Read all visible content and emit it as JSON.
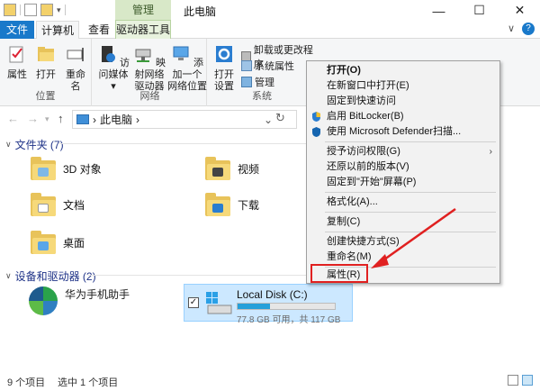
{
  "titlebar": {
    "manage_tab": "管理",
    "title": "此电脑",
    "minimize": "—",
    "maximize": "☐",
    "close": "✕"
  },
  "ribbon_tabs": {
    "file": "文件",
    "computer": "计算机",
    "view": "查看",
    "drive_tools": "驱动器工具",
    "chevron": "∨"
  },
  "ribbon": {
    "location": {
      "title": "位置",
      "properties": "属性",
      "open": "打开",
      "rename": "重命名"
    },
    "network": {
      "title": "网络",
      "access_media_line1": "访问媒体",
      "map_drive_line1": "映射网络",
      "map_drive_line2": "驱动器",
      "add_location_line1": "添加一个",
      "add_location_line2": "网络位置"
    },
    "system": {
      "title": "系统",
      "open_settings_line1": "打开",
      "open_settings_line2": "设置",
      "uninstall": "卸载或更改程序",
      "system_props": "系统属性",
      "manage": "管理"
    }
  },
  "navbar": {
    "back": "←",
    "forward": "→",
    "up": "↑",
    "address": "此电脑",
    "address_sep": "›",
    "dropdown": "⌄",
    "refresh": "↻"
  },
  "folders": {
    "header": "文件夹 (7)",
    "items": [
      {
        "label": "3D 对象"
      },
      {
        "label": "视频"
      },
      {
        "label": "文档"
      },
      {
        "label": "下载"
      },
      {
        "label": "桌面"
      }
    ]
  },
  "devices": {
    "header": "设备和驱动器 (2)",
    "phone_label": "华为手机助手",
    "drive": {
      "name": "Local Disk (C:)",
      "free_text": "77.8 GB 可用，共 117 GB",
      "used_fraction": 0.335,
      "checked": "✓"
    }
  },
  "context_menu": {
    "items": [
      {
        "label": "打开(O)",
        "bold": true
      },
      {
        "label": "在新窗口中打开(E)"
      },
      {
        "label": "固定到快速访问"
      },
      {
        "label": "启用 BitLocker(B)"
      },
      {
        "label": "使用 Microsoft Defender扫描..."
      },
      {
        "label": "授予访问权限(G)"
      },
      {
        "label": "还原以前的版本(V)"
      },
      {
        "label": "固定到\"开始\"屏幕(P)"
      },
      {
        "label": "格式化(A)..."
      },
      {
        "label": "复制(C)"
      },
      {
        "label": "创建快捷方式(S)"
      },
      {
        "label": "重命名(M)"
      },
      {
        "label": "属性(R)"
      }
    ],
    "submenu_arrow": "›"
  },
  "statusbar": {
    "items_count": "9 个项目",
    "selected": "选中 1 个项目"
  },
  "colors": {
    "accent": "#1979ca",
    "manage_tab": "#d8e8c8",
    "highlight_box": "#e02020",
    "selection": "#cce8ff"
  }
}
